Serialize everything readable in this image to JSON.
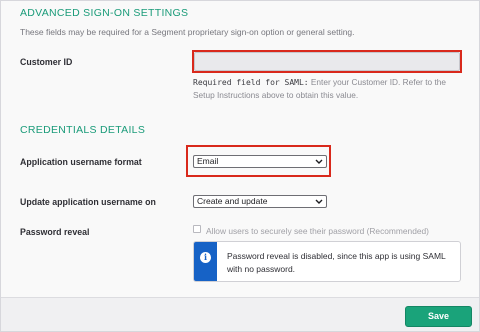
{
  "advanced": {
    "title": "ADVANCED SIGN-ON SETTINGS",
    "description": "These fields may be required for a Segment proprietary sign-on option or general setting."
  },
  "customer_id": {
    "label": "Customer ID",
    "value": "",
    "help_mono": "Required field for SAML:",
    "help_text": " Enter your Customer ID. Refer to the Setup Instructions above to obtain this value."
  },
  "credentials": {
    "title": "CREDENTIALS DETAILS"
  },
  "username_format": {
    "label": "Application username format",
    "selected": "Email"
  },
  "update_on": {
    "label": "Update application username on",
    "selected": "Create and update"
  },
  "password_reveal": {
    "label": "Password reveal",
    "checkbox_label": "Allow users to securely see their password (Recommended)",
    "checked": false,
    "callout_icon": "info-icon",
    "callout_message": "Password reveal is disabled, since this app is using SAML with no password."
  },
  "footer": {
    "save_label": "Save"
  },
  "colors": {
    "accent": "#1a9b79",
    "highlight": "#d9291c",
    "info": "#1662c6",
    "save": "#1aa37a"
  }
}
